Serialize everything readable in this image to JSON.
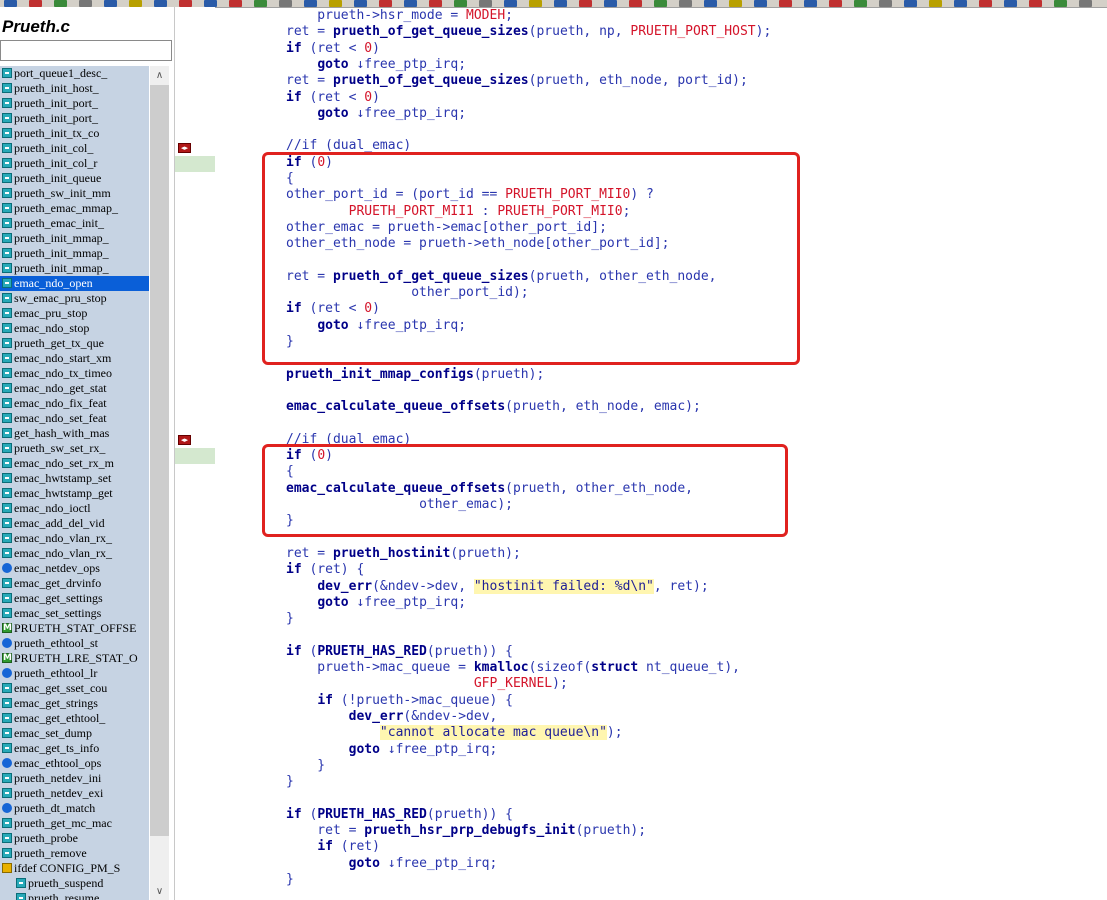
{
  "file_title": "Prueth.c",
  "search": {
    "value": ""
  },
  "symbols": [
    {
      "name": "port_queue1_desc_",
      "kind": "fn"
    },
    {
      "name": "prueth_init_host_",
      "kind": "fn"
    },
    {
      "name": "prueth_init_port_",
      "kind": "fn"
    },
    {
      "name": "prueth_init_port_",
      "kind": "fn"
    },
    {
      "name": "prueth_init_tx_co",
      "kind": "fn"
    },
    {
      "name": "prueth_init_col_",
      "kind": "fn"
    },
    {
      "name": "prueth_init_col_r",
      "kind": "fn"
    },
    {
      "name": "prueth_init_queue",
      "kind": "fn"
    },
    {
      "name": "prueth_sw_init_mm",
      "kind": "fn"
    },
    {
      "name": "prueth_emac_mmap_",
      "kind": "fn"
    },
    {
      "name": "prueth_emac_init_",
      "kind": "fn"
    },
    {
      "name": "prueth_init_mmap_",
      "kind": "fn"
    },
    {
      "name": "prueth_init_mmap_",
      "kind": "fn"
    },
    {
      "name": "prueth_init_mmap_",
      "kind": "fn"
    },
    {
      "name": "emac_ndo_open",
      "kind": "fn",
      "selected": true
    },
    {
      "name": "sw_emac_pru_stop",
      "kind": "fn"
    },
    {
      "name": "emac_pru_stop",
      "kind": "fn"
    },
    {
      "name": "emac_ndo_stop",
      "kind": "fn"
    },
    {
      "name": "prueth_get_tx_que",
      "kind": "fn"
    },
    {
      "name": "emac_ndo_start_xm",
      "kind": "fn"
    },
    {
      "name": "emac_ndo_tx_timeo",
      "kind": "fn"
    },
    {
      "name": "emac_ndo_get_stat",
      "kind": "fn"
    },
    {
      "name": "emac_ndo_fix_feat",
      "kind": "fn"
    },
    {
      "name": "emac_ndo_set_feat",
      "kind": "fn"
    },
    {
      "name": "get_hash_with_mas",
      "kind": "fn"
    },
    {
      "name": "prueth_sw_set_rx_",
      "kind": "fn"
    },
    {
      "name": "emac_ndo_set_rx_m",
      "kind": "fn"
    },
    {
      "name": "emac_hwtstamp_set",
      "kind": "fn"
    },
    {
      "name": "emac_hwtstamp_get",
      "kind": "fn"
    },
    {
      "name": "emac_ndo_ioctl",
      "kind": "fn"
    },
    {
      "name": "emac_add_del_vid",
      "kind": "fn"
    },
    {
      "name": "emac_ndo_vlan_rx_",
      "kind": "fn"
    },
    {
      "name": "emac_ndo_vlan_rx_",
      "kind": "fn"
    },
    {
      "name": "emac_netdev_ops",
      "kind": "st"
    },
    {
      "name": "emac_get_drvinfo",
      "kind": "fn"
    },
    {
      "name": "emac_get_settings",
      "kind": "fn"
    },
    {
      "name": "emac_set_settings",
      "kind": "fn"
    },
    {
      "name": "PRUETH_STAT_OFFSE",
      "kind": "mac"
    },
    {
      "name": "prueth_ethtool_st",
      "kind": "st"
    },
    {
      "name": "PRUETH_LRE_STAT_O",
      "kind": "mac"
    },
    {
      "name": "prueth_ethtool_lr",
      "kind": "st"
    },
    {
      "name": "emac_get_sset_cou",
      "kind": "fn"
    },
    {
      "name": "emac_get_strings",
      "kind": "fn"
    },
    {
      "name": "emac_get_ethtool_",
      "kind": "fn"
    },
    {
      "name": "emac_set_dump",
      "kind": "fn"
    },
    {
      "name": "emac_get_ts_info",
      "kind": "fn"
    },
    {
      "name": "emac_ethtool_ops",
      "kind": "st"
    },
    {
      "name": "prueth_netdev_ini",
      "kind": "fn"
    },
    {
      "name": "prueth_netdev_exi",
      "kind": "fn"
    },
    {
      "name": "prueth_dt_match",
      "kind": "st"
    },
    {
      "name": "prueth_get_mc_mac",
      "kind": "fn"
    },
    {
      "name": "prueth_probe",
      "kind": "fn"
    },
    {
      "name": "prueth_remove",
      "kind": "fn"
    },
    {
      "name": "ifdef CONFIG_PM_S",
      "kind": "ifd"
    },
    {
      "name": "prueth_suspend",
      "kind": "fn",
      "indent": true
    },
    {
      "name": "prueth_resume",
      "kind": "fn",
      "indent": true
    }
  ],
  "code_lines": [
    [
      [
        "    prueth->hsr_mode = ",
        "t"
      ],
      [
        "MODEH",
        "cn"
      ],
      [
        ";",
        "t"
      ]
    ],
    [
      [
        "ret = ",
        "t"
      ],
      [
        "prueth_of_get_queue_sizes",
        "fn"
      ],
      [
        "(prueth, np, ",
        "t"
      ],
      [
        "PRUETH_PORT_HOST",
        "cn"
      ],
      [
        ");",
        "t"
      ]
    ],
    [
      [
        "if",
        "kw"
      ],
      [
        " (ret < ",
        "t"
      ],
      [
        "0",
        "nm"
      ],
      [
        ")",
        "t"
      ]
    ],
    [
      [
        "    ",
        "t"
      ],
      [
        "goto",
        "kw"
      ],
      [
        " ↓free_ptp_irq;",
        "t"
      ]
    ],
    [
      [
        "ret = ",
        "t"
      ],
      [
        "prueth_of_get_queue_sizes",
        "fn"
      ],
      [
        "(prueth, eth_node, port_id);",
        "t"
      ]
    ],
    [
      [
        "if",
        "kw"
      ],
      [
        " (ret < ",
        "t"
      ],
      [
        "0",
        "nm"
      ],
      [
        ")",
        "t"
      ]
    ],
    [
      [
        "    ",
        "t"
      ],
      [
        "goto",
        "kw"
      ],
      [
        " ↓free_ptp_irq;",
        "t"
      ]
    ],
    [],
    [
      [
        "//if (dual_emac)",
        "cm"
      ]
    ],
    [
      [
        "if",
        "kw"
      ],
      [
        " (",
        "t"
      ],
      [
        "0",
        "nm"
      ],
      [
        ")",
        "t"
      ]
    ],
    [
      [
        "{",
        "t"
      ]
    ],
    [
      [
        "other_port_id = (port_id == ",
        "t"
      ],
      [
        "PRUETH_PORT_MII0",
        "cn"
      ],
      [
        ") ?",
        "t"
      ]
    ],
    [
      [
        "        ",
        "t"
      ],
      [
        "PRUETH_PORT_MII1",
        "cn"
      ],
      [
        " : ",
        "t"
      ],
      [
        "PRUETH_PORT_MII0",
        "cn"
      ],
      [
        ";",
        "t"
      ]
    ],
    [
      [
        "other_emac = prueth->emac[other_port_id];",
        "t"
      ]
    ],
    [
      [
        "other_eth_node = prueth->eth_node[other_port_id];",
        "t"
      ]
    ],
    [],
    [
      [
        "ret = ",
        "t"
      ],
      [
        "prueth_of_get_queue_sizes",
        "fn"
      ],
      [
        "(prueth, other_eth_node,",
        "t"
      ]
    ],
    [
      [
        "                ",
        "t"
      ],
      [
        "other_port_id);",
        "t"
      ]
    ],
    [
      [
        "if",
        "kw"
      ],
      [
        " (ret < ",
        "t"
      ],
      [
        "0",
        "nm"
      ],
      [
        ")",
        "t"
      ]
    ],
    [
      [
        "    ",
        "t"
      ],
      [
        "goto",
        "kw"
      ],
      [
        " ↓free_ptp_irq;",
        "t"
      ]
    ],
    [
      [
        "}",
        "t"
      ]
    ],
    [],
    [
      [
        "prueth_init_mmap_configs",
        "fn"
      ],
      [
        "(prueth);",
        "t"
      ]
    ],
    [],
    [
      [
        "emac_calculate_queue_offsets",
        "fn"
      ],
      [
        "(prueth, eth_node, emac);",
        "t"
      ]
    ],
    [],
    [
      [
        "//if (dual_emac)",
        "cm"
      ]
    ],
    [
      [
        "if",
        "kw"
      ],
      [
        " (",
        "t"
      ],
      [
        "0",
        "nm"
      ],
      [
        ")",
        "t"
      ]
    ],
    [
      [
        "{",
        "t"
      ]
    ],
    [
      [
        "emac_calculate_queue_offsets",
        "fn"
      ],
      [
        "(prueth, other_eth_node,",
        "t"
      ]
    ],
    [
      [
        "                 ",
        "t"
      ],
      [
        "other_emac);",
        "t"
      ]
    ],
    [
      [
        "}",
        "t"
      ]
    ],
    [],
    [
      [
        "ret = ",
        "t"
      ],
      [
        "prueth_hostinit",
        "fn"
      ],
      [
        "(prueth);",
        "t"
      ]
    ],
    [
      [
        "if",
        "kw"
      ],
      [
        " (ret) {",
        "t"
      ]
    ],
    [
      [
        "    ",
        "t"
      ],
      [
        "dev_err",
        "fn"
      ],
      [
        "(&ndev->dev, ",
        "t"
      ],
      [
        "\"hostinit failed: %d\\n\"",
        "str"
      ],
      [
        ", ret);",
        "t"
      ]
    ],
    [
      [
        "    ",
        "t"
      ],
      [
        "goto",
        "kw"
      ],
      [
        " ↓free_ptp_irq;",
        "t"
      ]
    ],
    [
      [
        "}",
        "t"
      ]
    ],
    [],
    [
      [
        "if",
        "kw"
      ],
      [
        " (",
        "t"
      ],
      [
        "PRUETH_HAS_RED",
        "fn"
      ],
      [
        "(prueth)) {",
        "t"
      ]
    ],
    [
      [
        "    prueth->mac_queue = ",
        "t"
      ],
      [
        "kmalloc",
        "fn"
      ],
      [
        "(sizeof(",
        "t"
      ],
      [
        "struct",
        "kw"
      ],
      [
        " nt_queue_t),",
        "t"
      ]
    ],
    [
      [
        "                        ",
        "t"
      ],
      [
        "GFP_KERNEL",
        "cn"
      ],
      [
        ");",
        "t"
      ]
    ],
    [
      [
        "    ",
        "t"
      ],
      [
        "if",
        "kw"
      ],
      [
        " (!prueth->mac_queue) {",
        "t"
      ]
    ],
    [
      [
        "        ",
        "t"
      ],
      [
        "dev_err",
        "fn"
      ],
      [
        "(&ndev->dev,",
        "t"
      ]
    ],
    [
      [
        "            ",
        "t"
      ],
      [
        "\"cannot allocate mac queue\\n\"",
        "str"
      ],
      [
        ");",
        "t"
      ]
    ],
    [
      [
        "        ",
        "t"
      ],
      [
        "goto",
        "kw"
      ],
      [
        " ↓free_ptp_irq;",
        "t"
      ]
    ],
    [
      [
        "    }",
        "t"
      ]
    ],
    [
      [
        "}",
        "t"
      ]
    ],
    [],
    [
      [
        "if",
        "kw"
      ],
      [
        " (",
        "t"
      ],
      [
        "PRUETH_HAS_RED",
        "fn"
      ],
      [
        "(prueth)) {",
        "t"
      ]
    ],
    [
      [
        "    ret = ",
        "t"
      ],
      [
        "prueth_hsr_prp_debugfs_init",
        "fn"
      ],
      [
        "(prueth);",
        "t"
      ]
    ],
    [
      [
        "    ",
        "t"
      ],
      [
        "if",
        "kw"
      ],
      [
        " (ret)",
        "t"
      ]
    ],
    [
      [
        "        ",
        "t"
      ],
      [
        "goto",
        "kw"
      ],
      [
        " ↓free_ptp_irq;",
        "t"
      ]
    ],
    [
      [
        "}",
        "t"
      ]
    ]
  ],
  "colors": {
    "selection": "#0a5fd8",
    "symbol_bg": "#c6d3e3",
    "highlight_box": "#e0221f",
    "identifier": "#2a36ae",
    "keyword": "#000088",
    "constant": "#d4142a"
  }
}
